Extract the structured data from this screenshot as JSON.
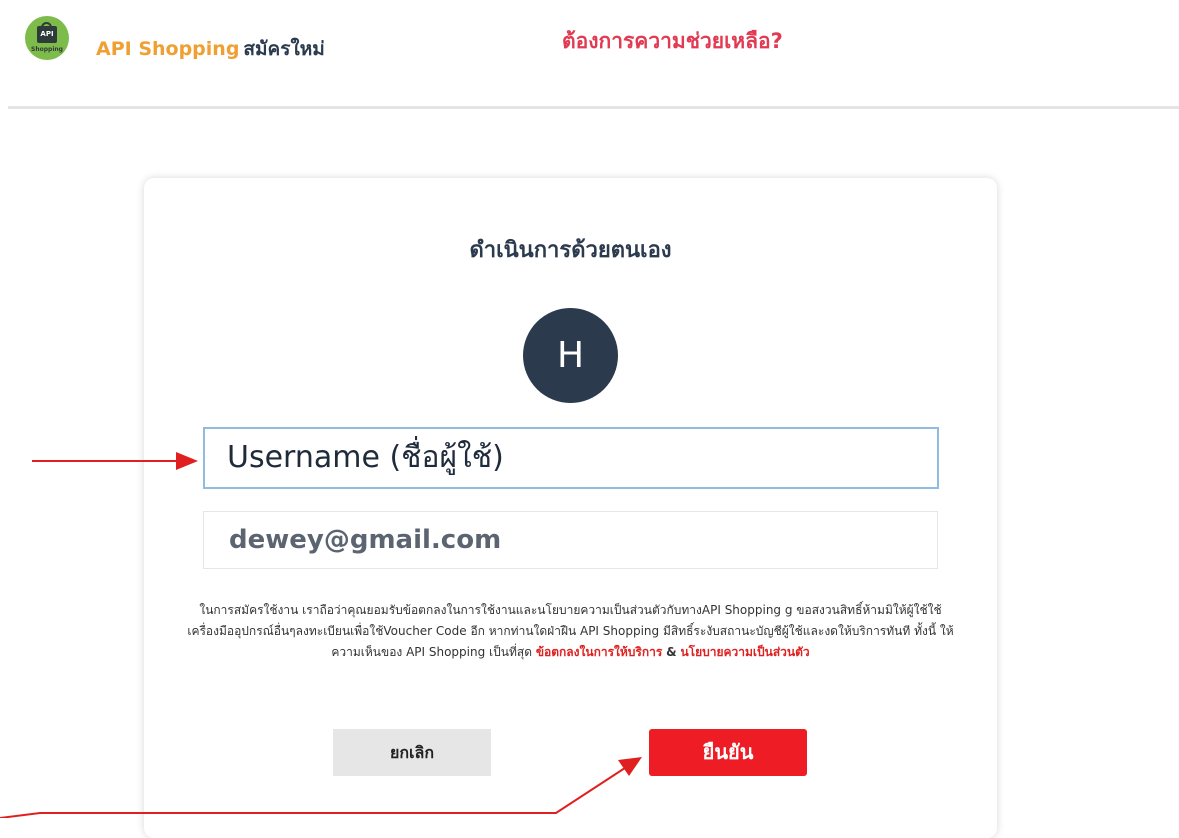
{
  "header": {
    "logo_text": "API",
    "logo_subtext": "Shopping",
    "brand_name": "API Shopping",
    "brand_action": "สมัครใหม่",
    "help_link": "ต้องการความช่วยเหลือ?"
  },
  "card": {
    "title": "ดำเนินการด้วยตนเอง",
    "avatar_initial": "H",
    "username_value": "Username (ชื่อผู้ใช้)",
    "email_value": "dewey@gmail.com",
    "terms_text": "ในการสมัครใช้งาน เราถือว่าคุณยอมรับข้อตกลงในการใช้งานและนโยบายความเป็นส่วนตัวกับทางAPI Shopping g ขอสงวนสิทธิ์ห้ามมิให้ผู้ใช้ใช้เครื่องมืออุปกรณ์อื่นๆลงทะเบียนเพื่อใช้Voucher Code อีก หากท่านใดฝ่าฝืน API Shopping มีสิทธิ์ระงับสถานะบัญชีผู้ใช้และงดให้บริการทันที ทั้งนี้ ให้ความเห็นของ API Shopping เป็นที่สุด",
    "terms_link_service": "ข้อตกลงในการให้บริการ",
    "terms_ampersand": "&",
    "terms_link_privacy": "นโยบายความเป็นส่วนตัว",
    "cancel_label": "ยกเลิก",
    "confirm_label": "ยืนยัน"
  },
  "colors": {
    "brand": "#f0a033",
    "help": "#e23a52",
    "navy": "#2c3a4e",
    "confirm": "#ee1c25",
    "arrow": "#e02020"
  }
}
